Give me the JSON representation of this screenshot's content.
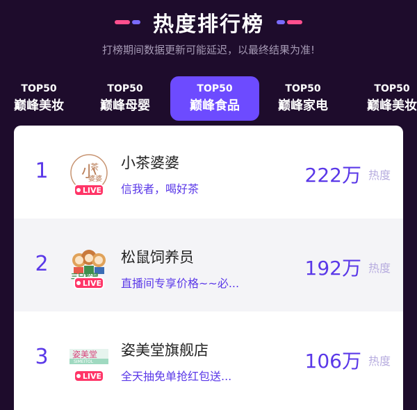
{
  "header": {
    "title": "热度排行榜",
    "subtitle": "打榜期间数据更新可能延迟，以最终结果为准!"
  },
  "tabs": [
    {
      "top": "TOP50",
      "name": "巅峰美妆",
      "active": false
    },
    {
      "top": "TOP50",
      "name": "巅峰母婴",
      "active": false
    },
    {
      "top": "TOP50",
      "name": "巅峰食品",
      "active": true
    },
    {
      "top": "TOP50",
      "name": "巅峰家电",
      "active": false
    },
    {
      "top": "TOP50",
      "name": "巅峰美妆",
      "active": false
    }
  ],
  "ranking": [
    {
      "rank": "1",
      "name": "小茶婆婆",
      "desc": "信我者，喝好茶",
      "heat": "222万",
      "heat_label": "热度",
      "live": "LIVE",
      "logo": "小茶婆婆-logo",
      "logo_text": [
        "小",
        "茶",
        "婆婆"
      ]
    },
    {
      "rank": "2",
      "name": "松鼠饲养员",
      "desc": "直播间专享价格~~必...",
      "heat": "192万",
      "heat_label": "热度",
      "live": "LIVE",
      "logo": "三只松鼠-logo",
      "logo_text": [
        "三只松鼠"
      ]
    },
    {
      "rank": "3",
      "name": "姿美堂旗舰店",
      "desc": "全天抽免单抢红包送...",
      "heat": "106万",
      "heat_label": "热度",
      "live": "LIVE",
      "logo": "姿美堂-logo",
      "logo_text": [
        "姿美堂",
        "SIMEITOL"
      ]
    }
  ],
  "colors": {
    "accent": "#6d4bff",
    "rank": "#5a38e8",
    "live": "#ff3567",
    "bg": "#1e0c2c"
  }
}
